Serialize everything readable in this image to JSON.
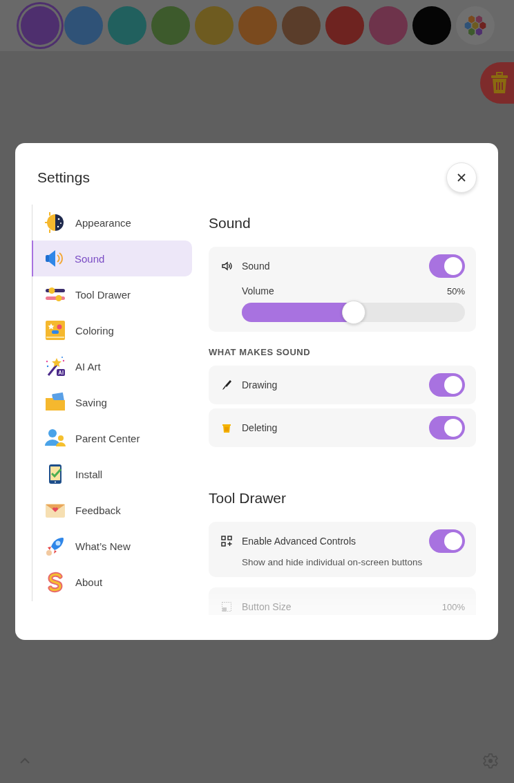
{
  "palette": {
    "swatches": [
      {
        "kind": "swatch",
        "color": "#4e2f6e",
        "selected": true
      },
      {
        "kind": "swatch",
        "color": "#2f5277",
        "selected": false
      },
      {
        "kind": "swatch",
        "color": "#21605e",
        "selected": false
      },
      {
        "kind": "swatch",
        "color": "#3d5a2c",
        "selected": false
      },
      {
        "kind": "swatch",
        "color": "#6e5b20",
        "selected": false
      },
      {
        "kind": "swatch",
        "color": "#7a4a1e",
        "selected": false
      },
      {
        "kind": "swatch",
        "color": "#5a3d2a",
        "selected": false
      },
      {
        "kind": "swatch",
        "color": "#6e2320",
        "selected": false
      },
      {
        "kind": "swatch",
        "color": "#6e334b",
        "selected": false
      },
      {
        "kind": "swatch",
        "color": "#050505",
        "selected": false
      },
      {
        "kind": "picker",
        "selected": false
      }
    ]
  },
  "dialog": {
    "title": "Settings",
    "sidebar": {
      "items": [
        {
          "label": "Appearance",
          "selected": false
        },
        {
          "label": "Sound",
          "selected": true
        },
        {
          "label": "Tool Drawer",
          "selected": false
        },
        {
          "label": "Coloring",
          "selected": false
        },
        {
          "label": "AI Art",
          "selected": false
        },
        {
          "label": "Saving",
          "selected": false
        },
        {
          "label": "Parent Center",
          "selected": false
        },
        {
          "label": "Install",
          "selected": false
        },
        {
          "label": "Feedback",
          "selected": false
        },
        {
          "label": "What’s New",
          "selected": false
        },
        {
          "label": "About",
          "selected": false
        }
      ]
    },
    "sections": [
      {
        "title": "Sound",
        "blocks": [
          {
            "kind": "card",
            "rows": [
              {
                "kind": "toggle",
                "label": "Sound",
                "on": true
              },
              {
                "kind": "slider",
                "label": "Volume",
                "reading": "50%",
                "level": 0.5
              }
            ]
          },
          {
            "kind": "caption",
            "text": "WHAT MAKES SOUND"
          },
          {
            "kind": "card",
            "rows": [
              {
                "kind": "toggle",
                "label": "Drawing",
                "on": true
              }
            ]
          },
          {
            "kind": "card",
            "rows": [
              {
                "kind": "toggle",
                "label": "Deleting",
                "on": true
              }
            ]
          }
        ]
      },
      {
        "title": "Tool Drawer",
        "blocks": [
          {
            "kind": "card",
            "rows": [
              {
                "kind": "toggle",
                "label": "Enable Advanced Controls",
                "on": true,
                "description": "Show and hide individual on-screen buttons"
              }
            ]
          },
          {
            "kind": "card",
            "rows": [
              {
                "kind": "value",
                "label": "Button Size",
                "reading": "100%"
              }
            ]
          }
        ]
      }
    ]
  }
}
